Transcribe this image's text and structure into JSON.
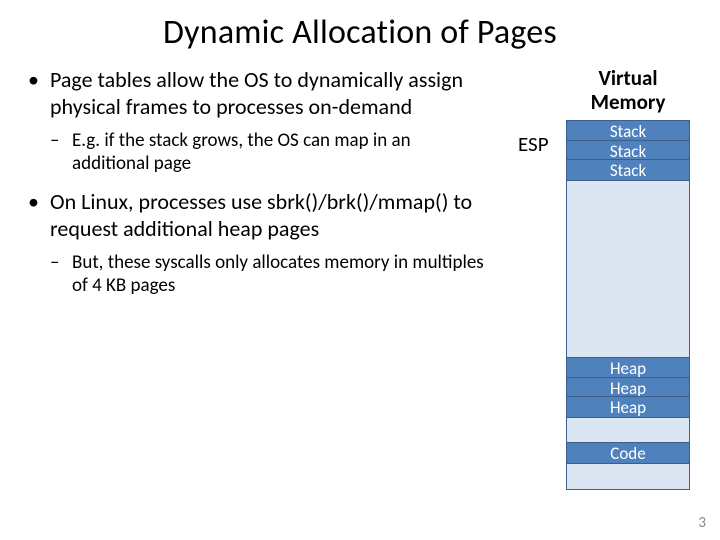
{
  "title": "Dynamic Allocation of Pages",
  "bullets": {
    "b1": "Page tables allow the OS to dynamically assign physical frames to processes on-demand",
    "b1s1": "E.g. if the stack grows, the OS can map in an additional page",
    "b2": "On Linux, processes use sbrk()/brk()/mmap() to request additional heap pages",
    "b2s1": "But, these syscalls only allocates memory in multiples of 4 KB pages"
  },
  "vm": {
    "label_l1": "Virtual",
    "label_l2": "Memory",
    "esp": "ESP",
    "stack1": "Stack",
    "stack2": "Stack",
    "stack3": "Stack",
    "heap1": "Heap",
    "heap2": "Heap",
    "heap3": "Heap",
    "code": "Code"
  },
  "page_number": "3"
}
